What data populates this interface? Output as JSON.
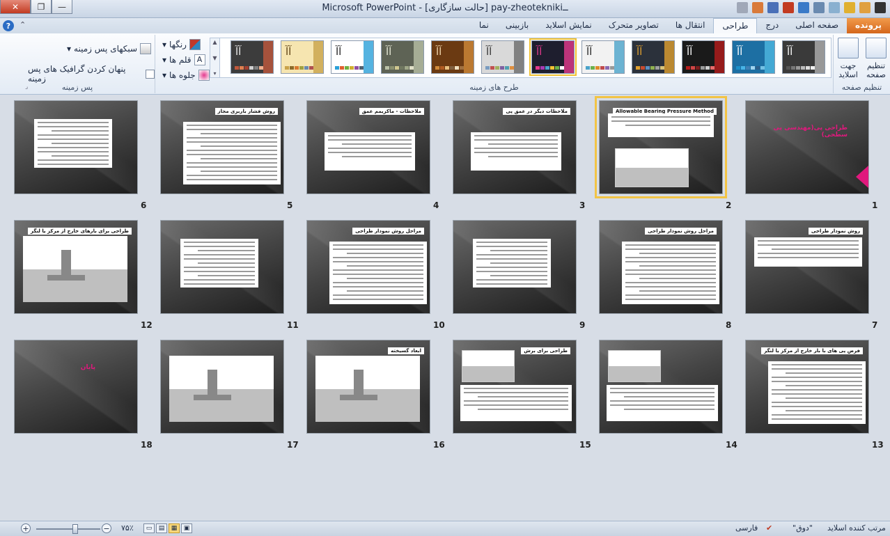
{
  "window": {
    "title": "Microsoft PowerPoint  -  [حالت سازگاری]  pay-zheoteknikiــ",
    "close_glyph": "✕",
    "restore_glyph": "❐",
    "minimize_glyph": "—"
  },
  "tabs": [
    {
      "label": "پرونده",
      "kind": "file"
    },
    {
      "label": "صفحه اصلی",
      "kind": "normal"
    },
    {
      "label": "درج",
      "kind": "normal"
    },
    {
      "label": "طراحی",
      "kind": "active"
    },
    {
      "label": "انتقال ها",
      "kind": "normal"
    },
    {
      "label": "تصاویر متحرک",
      "kind": "normal"
    },
    {
      "label": "نمایش اسلاید",
      "kind": "normal"
    },
    {
      "label": "بازبینی",
      "kind": "normal"
    },
    {
      "label": "نما",
      "kind": "normal"
    }
  ],
  "ribbon": {
    "page_setup": {
      "label": "تنظیم صفحه",
      "page_setup_button": "تنظیم صفحه",
      "orientation_button": "جهت اسلاید"
    },
    "themes": {
      "label": "طرح های زمینه",
      "items": [
        {
          "bg": "#3a3a3a",
          "accent": "#b0b0b0",
          "text": "#ffffff",
          "dots": [
            "#555",
            "#777",
            "#999",
            "#bbb",
            "#ddd",
            "#eee"
          ]
        },
        {
          "bg": "#1d6fa3",
          "accent": "#4fb8e0",
          "text": "#ffffff",
          "dots": [
            "#1b8fc9",
            "#48b4e6",
            "#3f7fb3",
            "#9fd3ee",
            "#2c5f8a",
            "#74c1e4"
          ]
        },
        {
          "bg": "#1a1a1a",
          "accent": "#b51c1c",
          "text": "#ffffff",
          "dots": [
            "#b51c1c",
            "#d04545",
            "#7a1d1d",
            "#999",
            "#ccc",
            "#e76b6b"
          ]
        },
        {
          "bg": "#2b313b",
          "accent": "#e0a030",
          "text": "#e0a030",
          "dots": [
            "#e0a030",
            "#c84a2f",
            "#5b8fc1",
            "#8fb050",
            "#a0a0a0",
            "#d9c37a"
          ]
        },
        {
          "bg": "#f2f2f2",
          "accent": "#4aa3c9",
          "text": "#222222",
          "dots": [
            "#4aa3c9",
            "#6ab04c",
            "#e08a2a",
            "#c04a4a",
            "#8a6ab0",
            "#999"
          ]
        },
        {
          "bg": "#1e1e2e",
          "accent": "#e4398d",
          "text": "#e4398d",
          "dots": [
            "#e4398d",
            "#a83ab0",
            "#4aa3c9",
            "#f2c233",
            "#6ab04c",
            "#ffffff"
          ],
          "selected": true
        },
        {
          "bg": "#d9d9d9",
          "accent": "#6a6a6a",
          "text": "#333333",
          "dots": [
            "#7a9cc0",
            "#c05050",
            "#a0b060",
            "#8060a0",
            "#50a0b0",
            "#e09040"
          ]
        },
        {
          "bg": "#6b3a12",
          "accent": "#d08a3a",
          "text": "#f2d8b0",
          "dots": [
            "#d08a3a",
            "#b05a20",
            "#e8c080",
            "#806040",
            "#f0e0c0",
            "#a07040"
          ]
        },
        {
          "bg": "#5e6355",
          "accent": "#b8bfa5",
          "text": "#e8ead8",
          "dots": [
            "#b8bfa5",
            "#8a9070",
            "#d0c890",
            "#707860",
            "#a0a888",
            "#e0e0c8"
          ]
        },
        {
          "bg": "#ffffff",
          "accent": "#2aa0d8",
          "text": "#1d1d1d",
          "dots": [
            "#2aa0d8",
            "#e06030",
            "#70b040",
            "#d0b030",
            "#9050a0",
            "#506070"
          ]
        },
        {
          "bg": "#f6e5b0",
          "accent": "#c9a24a",
          "text": "#5a3e10",
          "dots": [
            "#c9a24a",
            "#8b6a2a",
            "#d87a30",
            "#a0a040",
            "#6a8ab0",
            "#b05050"
          ]
        },
        {
          "bg": "#3c3c3c",
          "accent": "#c0583c",
          "text": "#f0f0f0",
          "dots": [
            "#c0583c",
            "#e08050",
            "#a04030",
            "#d0d0d0",
            "#808080",
            "#f0b090"
          ]
        }
      ]
    },
    "background": {
      "label": "پس زمینه",
      "colors": "رنگها",
      "fonts": "قلم ها",
      "effects": "جلوه ها",
      "background_styles": "سبکهای پس زمینه",
      "hide_background_graphics": "پنهان کردن گرافیک های پس زمینه"
    }
  },
  "slides": [
    {
      "num": "1",
      "kind": "title",
      "title": "طراحی پی(مهندسی پی سطحی)"
    },
    {
      "num": "2",
      "kind": "mixed",
      "title": "Allowable Bearing Pressure Method",
      "selected": true
    },
    {
      "num": "3",
      "kind": "list",
      "title": "ملاحظات دیگر در عمق پی"
    },
    {
      "num": "4",
      "kind": "list",
      "title": "ملاحظات - ماکزیمم عمق"
    },
    {
      "num": "5",
      "kind": "text",
      "title": "روش فشار باربری مجاز"
    },
    {
      "num": "6",
      "kind": "text",
      "title": ""
    },
    {
      "num": "7",
      "kind": "short",
      "title": "روش نمودار طراحی"
    },
    {
      "num": "8",
      "kind": "text",
      "title": "مراحل روش نمودار طراحی"
    },
    {
      "num": "9",
      "kind": "text",
      "title": ""
    },
    {
      "num": "10",
      "kind": "text",
      "title": "مراحل روش نمودار طراحی"
    },
    {
      "num": "11",
      "kind": "text",
      "title": ""
    },
    {
      "num": "12",
      "kind": "diagram",
      "title": "طراحی برای بارهای خارج از مرکز یا لنگر"
    },
    {
      "num": "13",
      "kind": "text",
      "title": "فرض پی های با بار خارج از مرکز یا لنگر"
    },
    {
      "num": "14",
      "kind": "formula",
      "title": ""
    },
    {
      "num": "15",
      "kind": "formula",
      "title": "طراحی برای برش"
    },
    {
      "num": "16",
      "kind": "diagram",
      "title": "ابعاد گسیخته"
    },
    {
      "num": "17",
      "kind": "diagram",
      "title": ""
    },
    {
      "num": "18",
      "kind": "title",
      "title": "پایان"
    }
  ],
  "status": {
    "view_label": "مرتب کننده اسلاید",
    "theme_name": "\"دوق\"",
    "language": "فارسی",
    "zoom": "۷۵٪",
    "zoom_minus": "−",
    "zoom_plus": "+"
  }
}
